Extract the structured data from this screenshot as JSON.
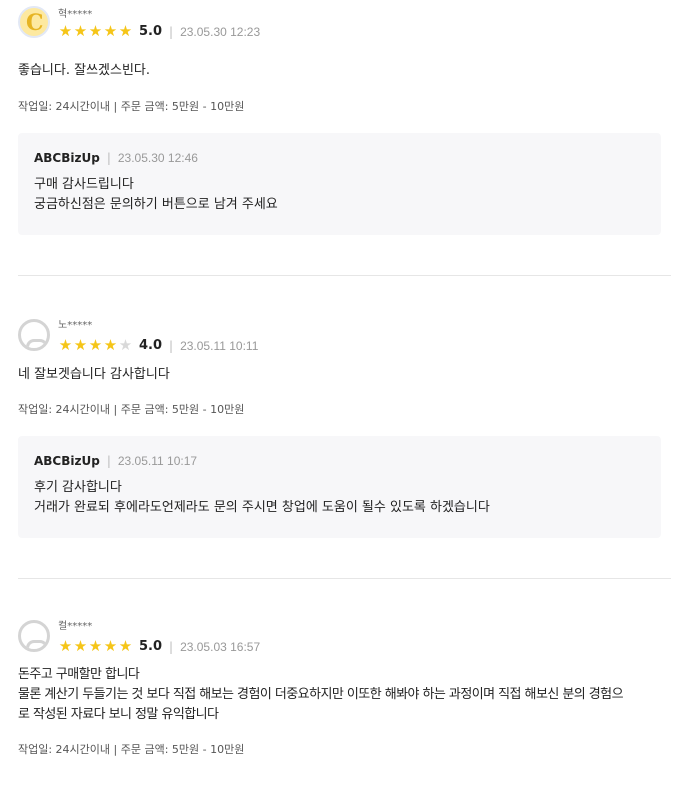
{
  "reviews": [
    {
      "name": "혁*****",
      "score": "5.0",
      "stars": [
        true,
        true,
        true,
        true,
        true
      ],
      "date": "23.05.30 12:23",
      "body": [
        "좋습니다. 잘쓰겠스빈다."
      ],
      "meta": "작업일: 24시간이내 | 주문 금액: 5만원 - 10만원",
      "reply": {
        "author": "ABCBizUp",
        "date": "23.05.30 12:46",
        "lines": [
          "구매 감사드립니다",
          "궁금하신점은 문의하기 버튼으로 남겨 주세요"
        ]
      }
    },
    {
      "name": "노*****",
      "score": "4.0",
      "stars": [
        true,
        true,
        true,
        true,
        false
      ],
      "date": "23.05.11 10:11",
      "body": [
        "네 잘보겟습니다 감사합니다"
      ],
      "meta": "작업일: 24시간이내 | 주문 금액: 5만원 - 10만원",
      "reply": {
        "author": "ABCBizUp",
        "date": "23.05.11 10:17",
        "lines": [
          "후기 감사합니다",
          "거래가 완료되 후에라도언제라도 문의 주시면 창업에  도움이 될수  있도록 하겠습니다"
        ]
      }
    },
    {
      "name": "컬*****",
      "score": "5.0",
      "stars": [
        true,
        true,
        true,
        true,
        true
      ],
      "date": "23.05.03 16:57",
      "body": [
        "돈주고 구매할만 합니다",
        "물론 계산기 두들기는 것 보다 직접 해보는 경험이 더중요하지만 이또한 해봐야 하는 과정이며 직접 해보신 분의 경험으",
        "로 작성된 자료다 보니 정말 유익합니다"
      ],
      "meta": "작업일: 24시간이내 | 주문 금액: 5만원 - 10만원"
    }
  ]
}
